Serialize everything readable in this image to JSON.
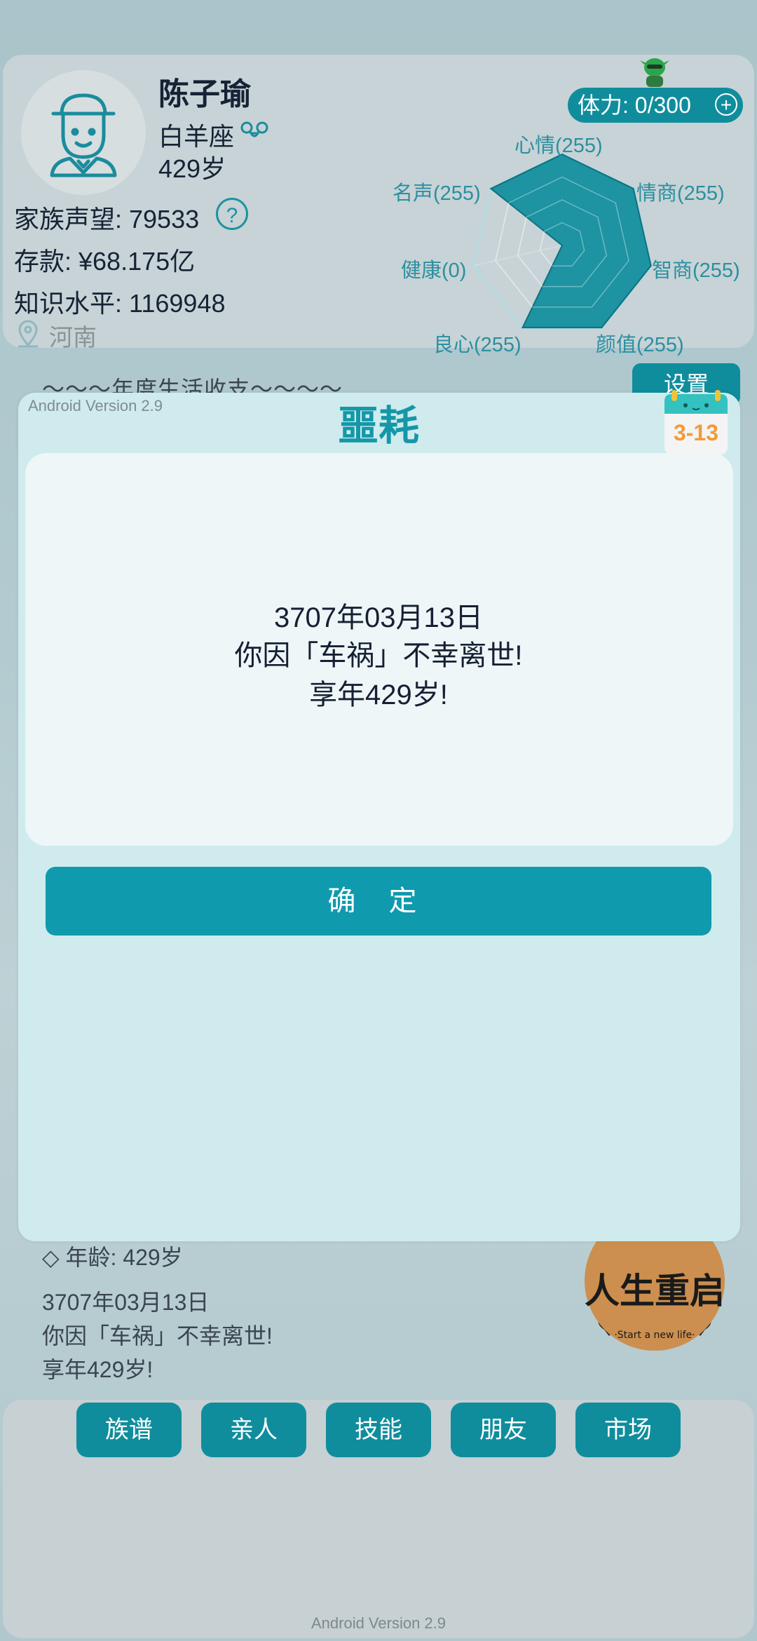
{
  "profile": {
    "name": "陈子瑜",
    "zodiac": "白羊座",
    "age": "429岁",
    "reputation": "家族声望: 79533",
    "savings": "存款: ¥68.175亿",
    "knowledge": "知识水平: 1169948",
    "location": "河南",
    "help": "?"
  },
  "stamina": {
    "label": "体力: 0/300",
    "plus": "+"
  },
  "radar": {
    "labels": {
      "mood": "心情(255)",
      "eq": "情商(255)",
      "iq": "智商(255)",
      "looks": "颜值(255)",
      "conscience": "良心(255)",
      "health": "健康(0)",
      "fame": "名声(255)"
    },
    "values": {
      "mood": 255,
      "eq": 255,
      "iq": 255,
      "looks": 255,
      "conscience": 255,
      "health": 0,
      "fame": 255
    },
    "max": 255,
    "fill_color": "#0f8d9d"
  },
  "background": {
    "yearly_heading": "～～～年度生活收支～～～～",
    "settings": "设置",
    "age_line": "◇  年龄: 429岁",
    "log_line1": "3707年03月13日",
    "log_line2": "你因「车祸」不幸离世!",
    "log_line3": "享年429岁!",
    "restart_badge_main": "人生重启",
    "restart_badge_sub": "·Start a new life·"
  },
  "modal": {
    "version": "Android Version 2.9",
    "title": "噩耗",
    "calendar_date": "3-13",
    "line1": "3707年03月13日",
    "line2": "你因「车祸」不幸离世!",
    "line3": "享年429岁!",
    "confirm": "确 定"
  },
  "nav": {
    "items": [
      "族谱",
      "亲人",
      "技能",
      "朋友",
      "市场"
    ]
  },
  "footer": {
    "version": "Android Version 2.9"
  },
  "colors": {
    "accent": "#0f8d9d",
    "title_accent": "#1498a8",
    "modal_bg": "#cfebee"
  }
}
